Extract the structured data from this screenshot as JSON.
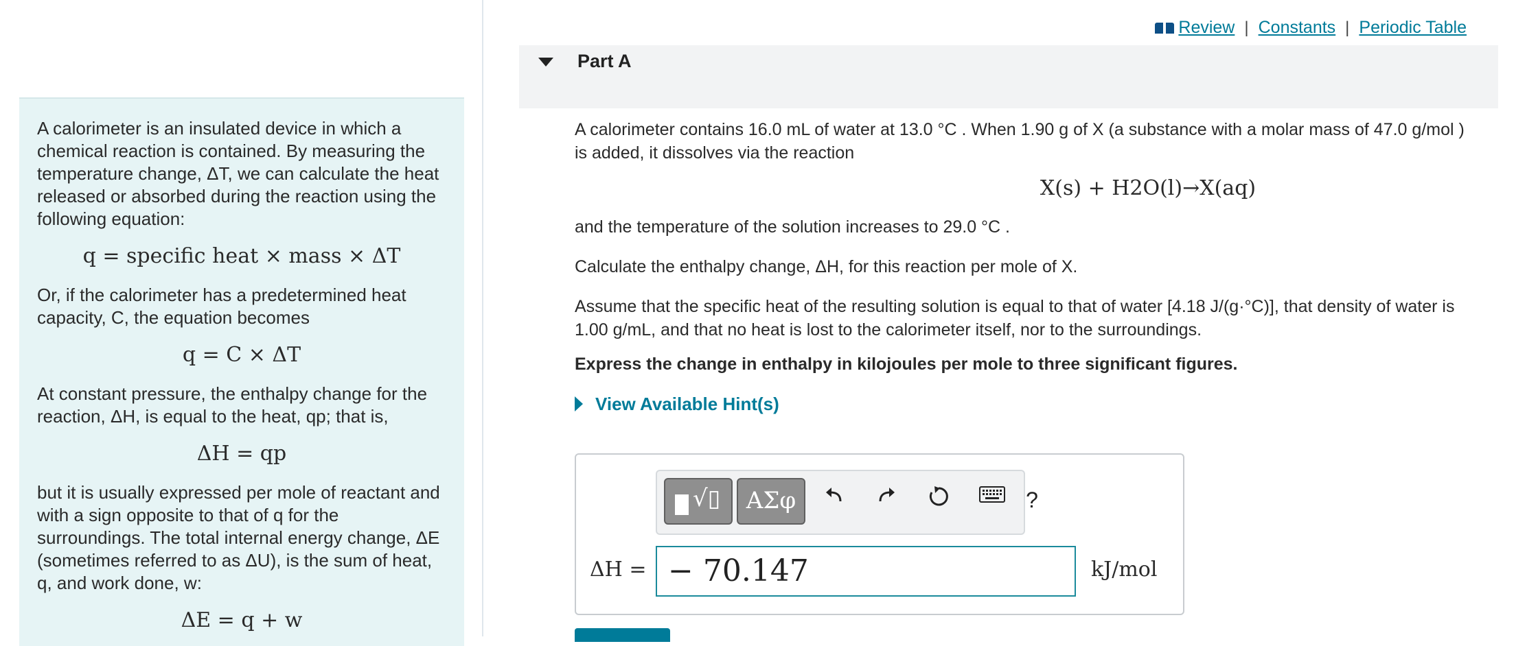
{
  "header": {
    "links": [
      {
        "label": "Review"
      },
      {
        "label": "Constants"
      },
      {
        "label": "Periodic Table"
      }
    ],
    "separator": "|"
  },
  "left_panel": {
    "p1": "A calorimeter is an insulated device in which a chemical reaction is contained. By measuring the temperature change, ΔT, we can calculate the heat released or absorbed during the reaction using the following equation:",
    "eq1": "q = specific heat × mass × ΔT",
    "p2": "Or, if the calorimeter has a predetermined heat capacity, C, the equation becomes",
    "eq2": "q = C × ΔT",
    "p3": "At constant pressure, the enthalpy change for the reaction, ΔH, is equal to the heat, qp; that is,",
    "eq3": "ΔH = qp",
    "p4": "but it is usually expressed per mole of reactant and with a sign opposite to that of q for the surroundings. The total internal energy change, ΔE (sometimes referred to as ΔU), is the sum of heat, q, and work done, w:",
    "eq4": "ΔE = q + w"
  },
  "part": {
    "title": "Part A"
  },
  "question": {
    "intro": "A calorimeter contains 16.0 mL of water at 13.0 °C . When 1.90 g of X (a substance with a molar mass of 47.0 g/mol ) is added, it dissolves via the reaction",
    "reaction": "X(s) + H2O(l)→X(aq)",
    "temp_line": "and the temperature of the solution increases to 29.0 °C .",
    "calc_line": "Calculate the enthalpy change, ΔH, for this reaction per mole of X.",
    "assume_line": "Assume that the specific heat of the resulting solution is equal to that of water [4.18 J/(g·°C)], that density of water is 1.00 g/mL, and that no heat is lost to the calorimeter itself, nor to the surroundings.",
    "instruction": "Express the change in enthalpy in kilojoules per mole to three significant figures.",
    "hints_label": "View Available Hint(s)"
  },
  "answer": {
    "greek_label": "ΑΣφ",
    "help_label": "?",
    "label": "ΔH =",
    "value": "− 70.147",
    "unit": "kJ/mol"
  }
}
